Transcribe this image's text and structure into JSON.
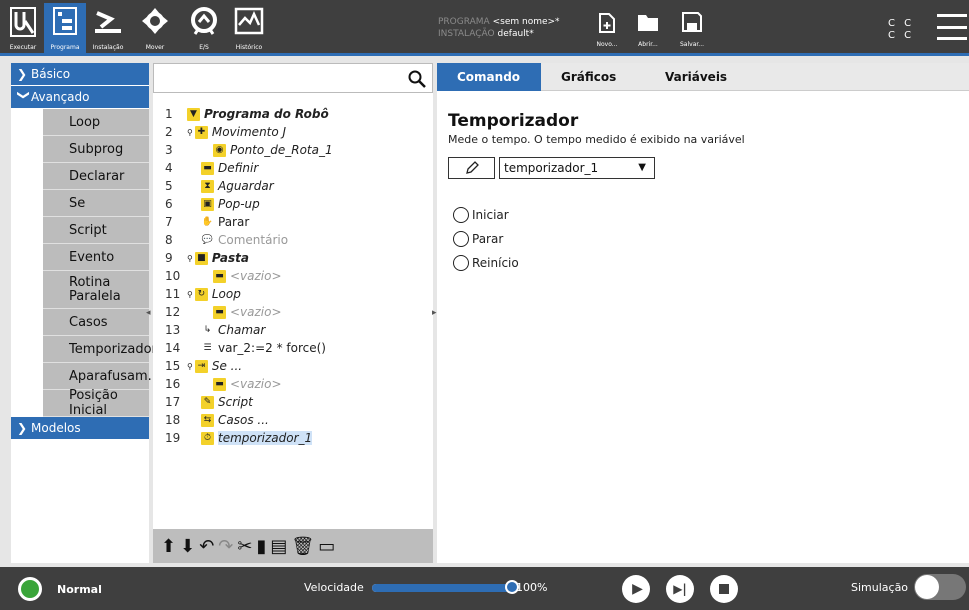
{
  "topbar": {
    "nav": [
      {
        "label": "Executar",
        "icon": "ur-logo-icon"
      },
      {
        "label": "Programa",
        "icon": "program-icon"
      },
      {
        "label": "Instalação",
        "icon": "installation-icon"
      },
      {
        "label": "Mover",
        "icon": "move-icon"
      },
      {
        "label": "E/S",
        "icon": "io-icon"
      },
      {
        "label": "Histórico",
        "icon": "log-icon"
      }
    ],
    "program_label": "PROGRAMA",
    "program_value": "<sem nome>*",
    "installation_label": "INSTALAÇÃO",
    "installation_value": "default*",
    "new_label": "Novo...",
    "open_label": "Abrir...",
    "save_label": "Salvar...",
    "cc_top": "C C",
    "cc_bottom": "C C"
  },
  "sidebar": {
    "basic": "Básico",
    "advanced": "Avançado",
    "items": [
      "Loop",
      "Subprog",
      "Declarar",
      "Se",
      "Script",
      "Evento",
      "Rotina Paralela",
      "Casos",
      "Temporizador",
      "Aparafusam...",
      "Posição Inicial"
    ],
    "models": "Modelos"
  },
  "tree": {
    "rows": [
      {
        "n": "1",
        "text": "Programa do Robô"
      },
      {
        "n": "2",
        "text": "Movimento J"
      },
      {
        "n": "3",
        "text": "Ponto_de_Rota_1"
      },
      {
        "n": "4",
        "text": "Definir"
      },
      {
        "n": "5",
        "text": "Aguardar"
      },
      {
        "n": "6",
        "text": "Pop-up"
      },
      {
        "n": "7",
        "text": "Parar"
      },
      {
        "n": "8",
        "text": "Comentário"
      },
      {
        "n": "9",
        "text": "Pasta"
      },
      {
        "n": "10",
        "text": "<vazio>"
      },
      {
        "n": "11",
        "text": "Loop"
      },
      {
        "n": "12",
        "text": "<vazio>"
      },
      {
        "n": "13",
        "text": "Chamar"
      },
      {
        "n": "14",
        "text": "var_2:=2 * force()"
      },
      {
        "n": "15",
        "text": "Se ..."
      },
      {
        "n": "16",
        "text": "<vazio>"
      },
      {
        "n": "17",
        "text": "Script"
      },
      {
        "n": "18",
        "text": "Casos ..."
      },
      {
        "n": "19",
        "text": "temporizador_1"
      }
    ]
  },
  "tabs": [
    "Comando",
    "Gráficos",
    "Variáveis"
  ],
  "timer": {
    "title": "Temporizador",
    "description": "Mede o tempo. O tempo medido é exibido na variável",
    "variable": "temporizador_1",
    "options": [
      "Iniciar",
      "Parar",
      "Reinício"
    ]
  },
  "bottom": {
    "status": "Normal",
    "speed_label": "Velocidade",
    "speed_value": "100%",
    "speed_fraction": 1.0,
    "sim_label": "Simulação"
  },
  "colors": {
    "accent": "#2e6db4",
    "bar": "#3f3f3f",
    "status_green": "#3aa53a",
    "node_yellow": "#f3d12a"
  }
}
